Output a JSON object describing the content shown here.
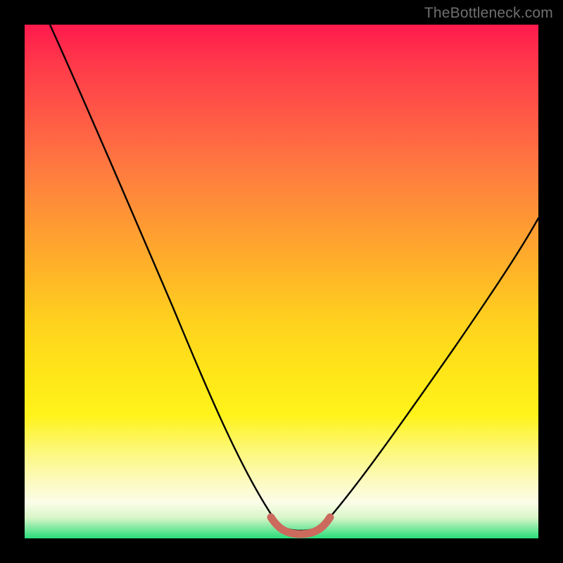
{
  "watermark": "TheBottleneck.com",
  "colors": {
    "frame_bg": "#000000",
    "curve_stroke": "#000000",
    "highlight_stroke": "#cc6a5e",
    "watermark_text": "#6f6f6f"
  },
  "chart_data": {
    "type": "line",
    "title": "",
    "xlabel": "",
    "ylabel": "",
    "xlim": [
      0,
      100
    ],
    "ylim": [
      0,
      100
    ],
    "grid": false,
    "legend": false,
    "curve_left": {
      "x": [
        5,
        10,
        15,
        20,
        25,
        30,
        35,
        40,
        45,
        50
      ],
      "y": [
        100,
        89,
        78,
        67,
        56,
        45,
        34,
        23,
        12,
        3
      ]
    },
    "curve_right": {
      "x": [
        58,
        63,
        68,
        73,
        78,
        83,
        88,
        93,
        98,
        100
      ],
      "y": [
        3,
        9,
        16,
        23,
        30,
        37,
        44,
        52,
        60,
        63
      ]
    },
    "bottom_flat": {
      "x": [
        50,
        52,
        54,
        56,
        58
      ],
      "y": [
        3,
        2.2,
        2,
        2.2,
        3
      ]
    },
    "highlight_segment": {
      "x": [
        49,
        51,
        53,
        55,
        57,
        59
      ],
      "y": [
        4.5,
        2.5,
        2,
        2,
        2.5,
        4.5
      ]
    },
    "note": "Axes are unitless (0–100). Values estimated from pixel positions: curve minimum ≈ y 2 at x 54; left branch starts at top-left corner; right branch exits right edge near y 63."
  }
}
